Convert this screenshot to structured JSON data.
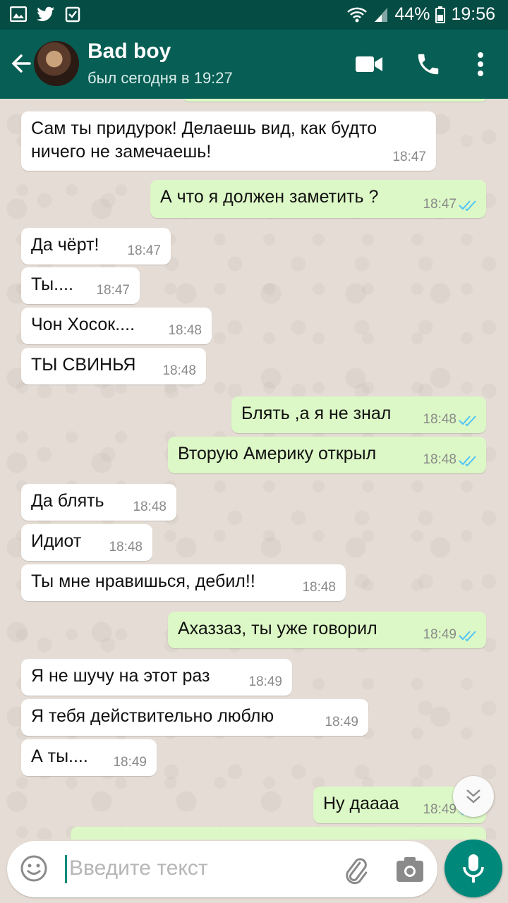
{
  "status_bar": {
    "battery": "44%",
    "time": "19:56"
  },
  "header": {
    "contact_name": "Bad boy",
    "last_seen": "был сегодня в 19:27"
  },
  "messages": [
    {
      "dir": "in",
      "lines": [
        "Сам ты придурок! Делаешь вид, как будто",
        "ничего не замечаешь!"
      ],
      "time": "18:47"
    },
    {
      "dir": "out",
      "text": "А что я должен заметить ?",
      "time": "18:47",
      "status": "read"
    },
    {
      "dir": "in",
      "text": "Да чёрт!",
      "time": "18:47"
    },
    {
      "dir": "in",
      "text": "Ты....",
      "time": "18:47"
    },
    {
      "dir": "in",
      "text": "Чон Хосок....",
      "time": "18:48"
    },
    {
      "dir": "in",
      "text": "ТЫ СВИНЬЯ",
      "time": "18:48"
    },
    {
      "dir": "out",
      "text": "Блять ,а я не знал",
      "time": "18:48",
      "status": "read"
    },
    {
      "dir": "out",
      "text": "Вторую Америку открыл",
      "time": "18:48",
      "status": "read"
    },
    {
      "dir": "in",
      "text": "Да блять",
      "time": "18:48"
    },
    {
      "dir": "in",
      "text": "Идиот",
      "time": "18:48"
    },
    {
      "dir": "in",
      "text": "Ты мне нравишься, дебил!!",
      "time": "18:48"
    },
    {
      "dir": "out",
      "text": "Ахаззаз, ты уже говорил",
      "time": "18:49",
      "status": "read"
    },
    {
      "dir": "in",
      "text": "Я не шучу на этот раз",
      "time": "18:49"
    },
    {
      "dir": "in",
      "text": "Я тебя действительно люблю",
      "time": "18:49"
    },
    {
      "dir": "in",
      "text": "А ты....",
      "time": "18:49"
    },
    {
      "dir": "out",
      "text": "Ну даааа",
      "time": "18:49",
      "status": "read"
    }
  ],
  "input": {
    "placeholder": "Введите текст"
  },
  "colors": {
    "header": "#075e54",
    "status_bar": "#054d44",
    "outgoing_bubble": "#dcf8c6",
    "incoming_bubble": "#ffffff",
    "read_ticks": "#4fc3f7",
    "mic_button": "#00897b"
  },
  "icons": [
    "image-icon",
    "twitter-icon",
    "checkbox-icon",
    "wifi-icon",
    "signal-icon",
    "battery-icon",
    "back-arrow-icon",
    "video-call-icon",
    "phone-icon",
    "more-icon",
    "emoji-icon",
    "attach-icon",
    "camera-icon",
    "mic-icon",
    "chevron-down-icon"
  ]
}
